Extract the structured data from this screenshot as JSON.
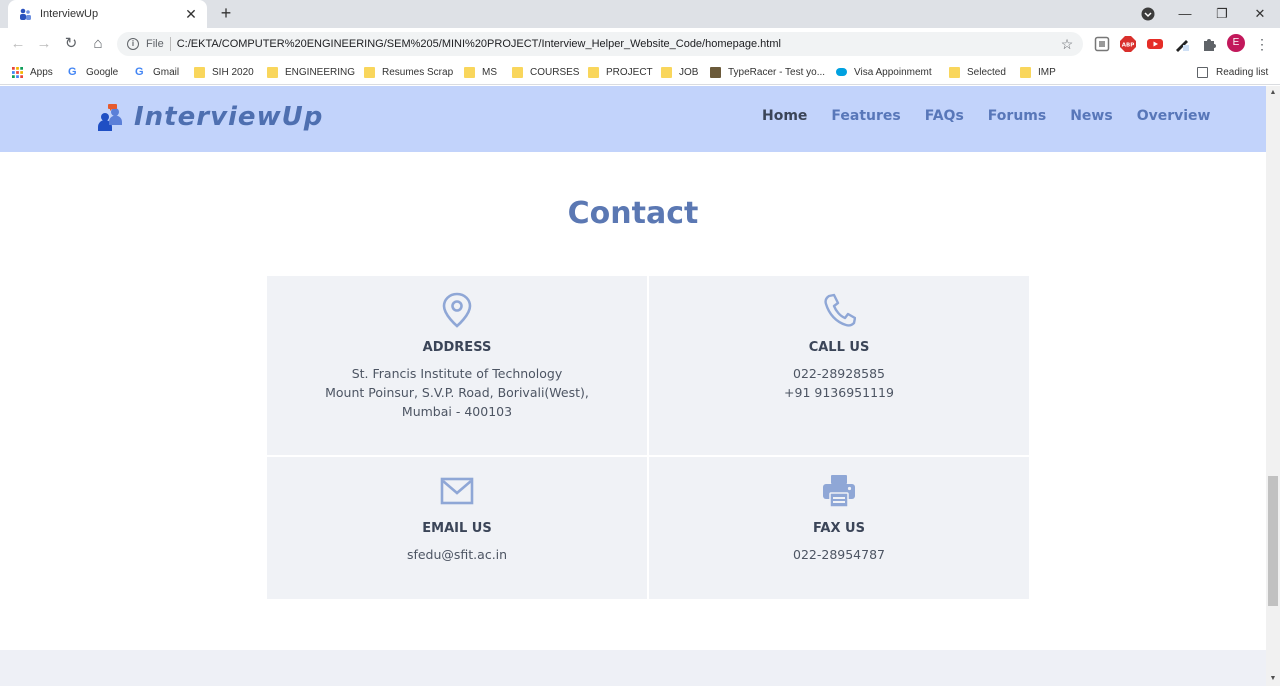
{
  "browser": {
    "tab_title": "InterviewUp",
    "omnibox_label": "File",
    "url": "C:/EKTA/COMPUTER%20ENGINEERING/SEM%205/MINI%20PROJECT/Interview_Helper_Website_Code/homepage.html",
    "profile_initial": "E",
    "bookmarks": [
      {
        "label": "Apps",
        "icon": "apps-grid-icon"
      },
      {
        "label": "Google",
        "icon": "google-icon"
      },
      {
        "label": "Gmail",
        "icon": "google-icon"
      },
      {
        "label": "SIH 2020",
        "icon": "folder-icon"
      },
      {
        "label": "ENGINEERING",
        "icon": "folder-icon"
      },
      {
        "label": "Resumes Scrap",
        "icon": "folder-icon"
      },
      {
        "label": "MS",
        "icon": "folder-icon"
      },
      {
        "label": "COURSES",
        "icon": "folder-icon"
      },
      {
        "label": "PROJECT",
        "icon": "folder-icon"
      },
      {
        "label": "JOB",
        "icon": "folder-icon"
      },
      {
        "label": "TypeRacer - Test yo...",
        "icon": "typeracer-icon"
      },
      {
        "label": "Visa Appoinmemt",
        "icon": "salesforce-icon"
      },
      {
        "label": "Selected",
        "icon": "folder-icon"
      },
      {
        "label": "IMP",
        "icon": "folder-icon"
      }
    ],
    "reading_list": "Reading list"
  },
  "site": {
    "logo_text": "InterviewUp",
    "nav": [
      {
        "label": "Home",
        "active": true
      },
      {
        "label": "Features",
        "active": false
      },
      {
        "label": "FAQs",
        "active": false
      },
      {
        "label": "Forums",
        "active": false
      },
      {
        "label": "News",
        "active": false
      },
      {
        "label": "Overview",
        "active": false
      }
    ],
    "section_title": "Contact",
    "contact": {
      "address": {
        "title": "ADDRESS",
        "icon": "map-pin-icon",
        "lines": [
          "St. Francis Institute of Technology",
          "Mount Poinsur, S.V.P. Road, Borivali(West),",
          "Mumbai - 400103"
        ]
      },
      "call": {
        "title": "CALL US",
        "icon": "phone-icon",
        "lines": [
          "022-28928585",
          "+91 9136951119"
        ]
      },
      "email": {
        "title": "EMAIL US",
        "icon": "envelope-icon",
        "lines": [
          "sfedu@sfit.ac.in"
        ]
      },
      "fax": {
        "title": "FAX US",
        "icon": "printer-icon",
        "lines": [
          "022-28954787"
        ]
      }
    }
  },
  "colors": {
    "header_bg": "#c2d3fb",
    "accent": "#5b78b3",
    "card_bg": "#f0f2f6",
    "icon": "#8fa7d6"
  }
}
